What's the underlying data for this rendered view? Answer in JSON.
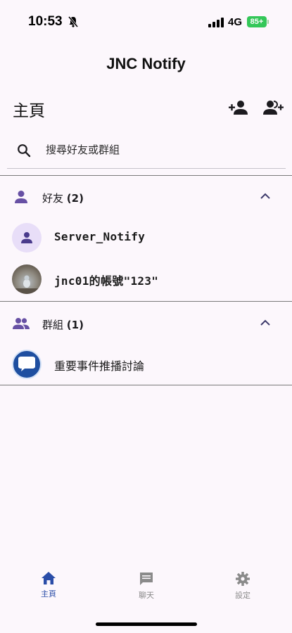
{
  "status_bar": {
    "time": "10:53",
    "network": "4G",
    "battery": "85+"
  },
  "app": {
    "title": "JNC Notify"
  },
  "header": {
    "page_title": "主頁",
    "actions": [
      "add-friend-icon",
      "add-group-icon"
    ]
  },
  "search": {
    "placeholder": "搜尋好友或群組"
  },
  "sections": {
    "friends": {
      "label": "好友",
      "count": "(2)",
      "items": [
        {
          "name": "Server_Notify",
          "avatar": "default-person-icon"
        },
        {
          "name": "jnc01的帳號\"123\"",
          "avatar": "photo"
        }
      ]
    },
    "groups": {
      "label": "群組",
      "count": "(1)",
      "items": [
        {
          "name": "重要事件推播討論",
          "avatar": "jnc-logo"
        }
      ]
    }
  },
  "bottom_nav": {
    "items": [
      {
        "label": "主頁",
        "icon": "home-icon",
        "active": true
      },
      {
        "label": "聊天",
        "icon": "chat-icon",
        "active": false
      },
      {
        "label": "設定",
        "icon": "gear-icon",
        "active": false
      }
    ]
  },
  "colors": {
    "background": "#fcf7fc",
    "accent": "#6750a4",
    "nav_active": "#2a4da8",
    "battery": "#34c759"
  }
}
